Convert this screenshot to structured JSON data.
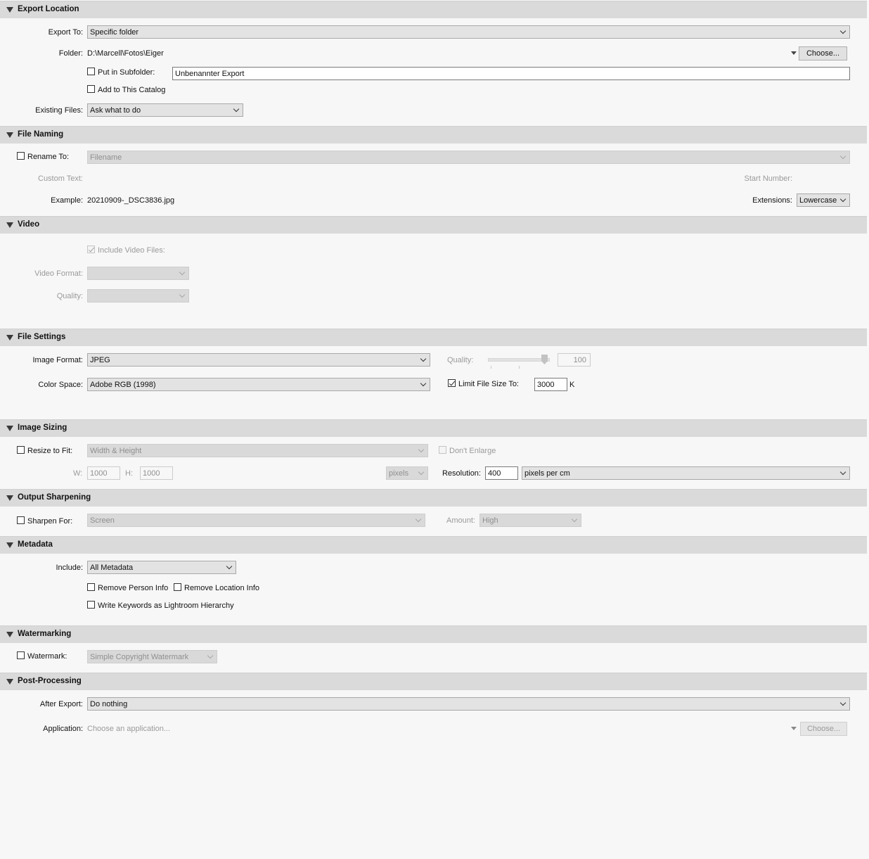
{
  "sections": {
    "export_location": "Export Location",
    "file_naming": "File Naming",
    "video": "Video",
    "file_settings": "File Settings",
    "image_sizing": "Image Sizing",
    "output_sharpening": "Output Sharpening",
    "metadata": "Metadata",
    "watermarking": "Watermarking",
    "post_processing": "Post-Processing"
  },
  "export_location": {
    "export_to_label": "Export To:",
    "export_to_value": "Specific folder",
    "folder_label": "Folder:",
    "folder_value": "D:\\Marcell\\Fotos\\Eiger",
    "choose_button": "Choose...",
    "put_in_subfolder_label": "Put in Subfolder:",
    "put_in_subfolder_checked": false,
    "subfolder_value": "Unbenannter Export",
    "add_to_catalog_label": "Add to This Catalog",
    "add_to_catalog_checked": false,
    "existing_files_label": "Existing Files:",
    "existing_files_value": "Ask what to do"
  },
  "file_naming": {
    "rename_to_label": "Rename To:",
    "rename_to_checked": false,
    "rename_template_value": "Filename",
    "custom_text_label": "Custom Text:",
    "start_number_label": "Start Number:",
    "example_label": "Example:",
    "example_value": "20210909-_DSC3836.jpg",
    "extensions_label": "Extensions:",
    "extensions_value": "Lowercase"
  },
  "video": {
    "include_video_label": "Include Video Files:",
    "include_video_checked": true,
    "video_format_label": "Video Format:",
    "video_format_value": "",
    "quality_label": "Quality:",
    "quality_value": ""
  },
  "file_settings": {
    "image_format_label": "Image Format:",
    "image_format_value": "JPEG",
    "quality_label": "Quality:",
    "quality_value": "100",
    "color_space_label": "Color Space:",
    "color_space_value": "Adobe RGB (1998)",
    "limit_size_label": "Limit File Size To:",
    "limit_size_checked": true,
    "limit_size_value": "3000",
    "limit_size_unit": "K"
  },
  "image_sizing": {
    "resize_label": "Resize to Fit:",
    "resize_checked": false,
    "resize_mode_value": "Width & Height",
    "dont_enlarge_label": "Don't Enlarge",
    "w_label": "W:",
    "w_value": "1000",
    "h_label": "H:",
    "h_value": "1000",
    "units_value": "pixels",
    "resolution_label": "Resolution:",
    "resolution_value": "400",
    "resolution_unit_value": "pixels per cm"
  },
  "output_sharpening": {
    "sharpen_label": "Sharpen For:",
    "sharpen_checked": false,
    "sharpen_value": "Screen",
    "amount_label": "Amount:",
    "amount_value": "High"
  },
  "metadata": {
    "include_label": "Include:",
    "include_value": "All Metadata",
    "remove_person_label": "Remove Person Info",
    "remove_location_label": "Remove Location Info",
    "write_keywords_label": "Write Keywords as Lightroom Hierarchy"
  },
  "watermarking": {
    "watermark_label": "Watermark:",
    "watermark_checked": false,
    "watermark_value": "Simple Copyright Watermark"
  },
  "post_processing": {
    "after_export_label": "After Export:",
    "after_export_value": "Do nothing",
    "application_label": "Application:",
    "application_placeholder": "Choose an application...",
    "choose_button": "Choose..."
  },
  "colors": {
    "panel_bg": "#f7f7f7",
    "header_bg": "#dadada",
    "disabled_text": "#9a9a9a"
  }
}
